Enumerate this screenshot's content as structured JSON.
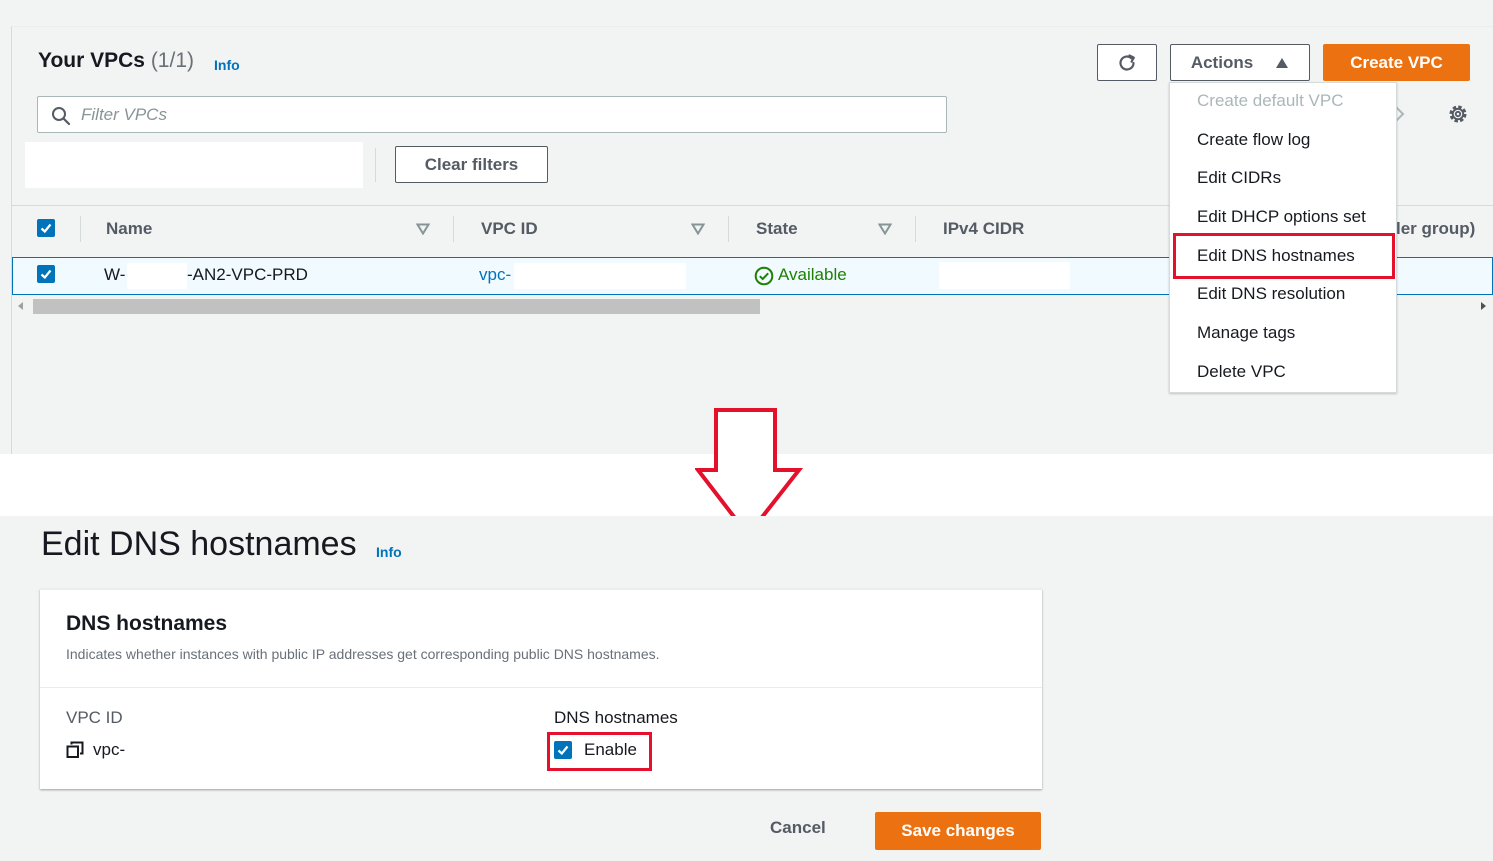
{
  "vpcs_page": {
    "heading": "Your VPCs",
    "count": "(1/1)",
    "info": "Info",
    "refresh_icon": "refresh-icon",
    "actions_label": "Actions",
    "create_vpc_label": "Create VPC",
    "filter_placeholder": "Filter VPCs",
    "clear_filters_label": "Clear filters",
    "columns": {
      "name": "Name",
      "vpc_id": "VPC ID",
      "state": "State",
      "ipv4_cidr": "IPv4 CIDR",
      "trailing_partial": "ler group)"
    },
    "row": {
      "name_prefix": "W-",
      "name_suffix": "-AN2-VPC-PRD",
      "vpc_id": "vpc-",
      "state": "Available"
    }
  },
  "actions_menu": {
    "items": [
      {
        "label": "Create default VPC",
        "disabled": true
      },
      {
        "label": "Create flow log",
        "disabled": false
      },
      {
        "label": "Edit CIDRs",
        "disabled": false
      },
      {
        "label": "Edit DHCP options set",
        "disabled": false
      },
      {
        "label": "Edit DNS hostnames",
        "disabled": false,
        "highlighted": true
      },
      {
        "label": "Edit DNS resolution",
        "disabled": false
      },
      {
        "label": "Manage tags",
        "disabled": false
      },
      {
        "label": "Delete VPC",
        "disabled": false
      }
    ]
  },
  "edit_dns_page": {
    "title": "Edit DNS hostnames",
    "info": "Info",
    "card": {
      "title": "DNS hostnames",
      "description": "Indicates whether instances with public IP addresses get corresponding public DNS hostnames.",
      "vpc_id_label": "VPC ID",
      "vpc_id_value": "vpc-",
      "dns_label": "DNS hostnames",
      "enable_label": "Enable",
      "enable_checked": true
    },
    "cancel_label": "Cancel",
    "save_label": "Save changes"
  },
  "colors": {
    "accent_orange": "#ec7211",
    "link_blue": "#0073bb",
    "success_green": "#1d8102",
    "highlight_red": "#e3112b"
  }
}
